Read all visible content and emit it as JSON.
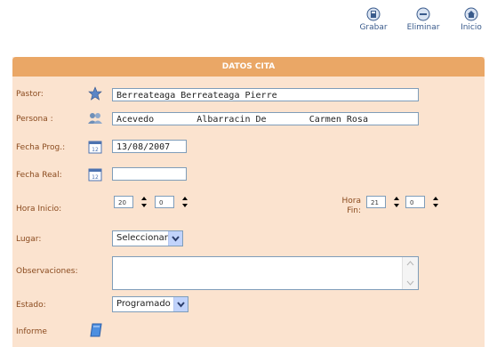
{
  "toolbar": {
    "save_label": "Grabar",
    "delete_label": "Eliminar",
    "home_label": "Inicio"
  },
  "panel": {
    "title": "DATOS CITA"
  },
  "form": {
    "pastor": {
      "label": "Pastor:",
      "value": "Berreateaga Berreateaga Pierre"
    },
    "persona": {
      "label": "Persona :",
      "value": "Acevedo        Albarracin De        Carmen Rosa"
    },
    "fecha_prog": {
      "label": "Fecha Prog.:",
      "value": "13/08/2007"
    },
    "fecha_real": {
      "label": "Fecha Real:",
      "value": ""
    },
    "hora_inicio": {
      "label": "Hora Inicio:",
      "hour": "20",
      "minute": "0"
    },
    "hora_fin": {
      "label_line1": "Hora",
      "label_line2": "Fin:",
      "hour": "21",
      "minute": "0"
    },
    "lugar": {
      "label": "Lugar:",
      "value": "Seleccionar"
    },
    "observaciones": {
      "label": "Observaciones:",
      "value": ""
    },
    "estado": {
      "label": "Estado:",
      "value": "Programado"
    },
    "informe": {
      "label": "Informe"
    }
  },
  "colors": {
    "header_bg": "#eaa766",
    "panel_bg": "#fbe3cf",
    "label_text": "#8a4a1e",
    "toolbar_text": "#3a5b8c"
  },
  "icons": {
    "save": "save-icon",
    "delete": "minus-circle-icon",
    "home": "home-icon",
    "pastor": "star-icon",
    "persona": "people-icon",
    "calendar": "calendar-icon",
    "informe": "document-icon"
  }
}
